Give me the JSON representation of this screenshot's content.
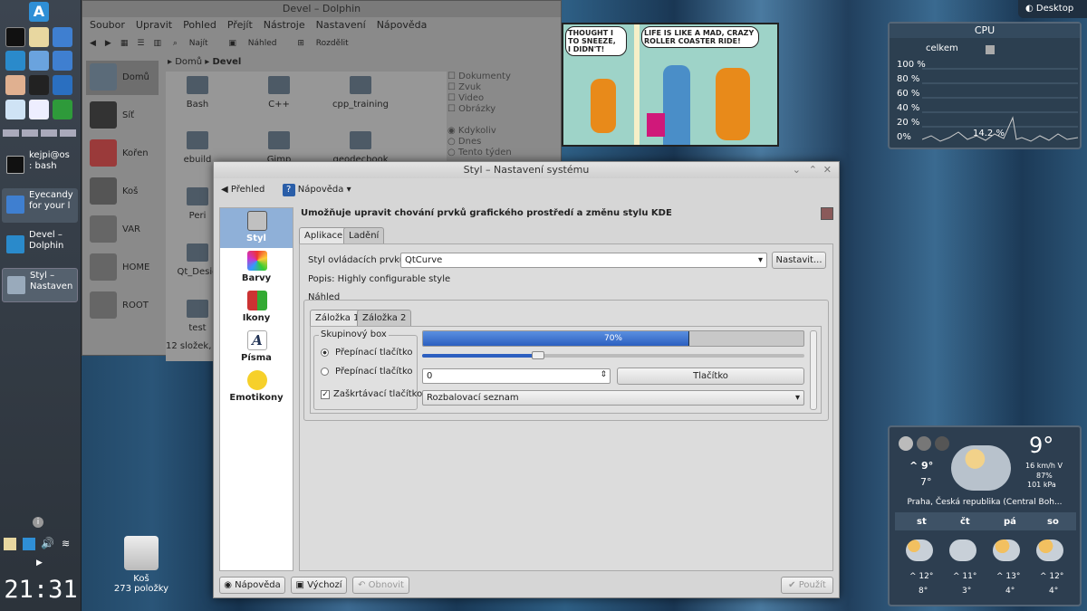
{
  "panel": {
    "clock": "21:31",
    "tasks": [
      {
        "label": "kejpi@os\n: bash"
      },
      {
        "label": "Eyecandy\nfor your l"
      },
      {
        "label": "Devel –\nDolphin"
      },
      {
        "label": "Styl –\nNastaven"
      }
    ]
  },
  "desktop": {
    "top_label": "Desktop",
    "trash_name": "Koš",
    "trash_count": "273 položky"
  },
  "dolphin": {
    "title": "Devel – Dolphin",
    "menu": [
      "Soubor",
      "Upravit",
      "Pohled",
      "Přejít",
      "Nástroje",
      "Nastavení",
      "Nápověda"
    ],
    "toolbar": [
      "Najít",
      "Náhled",
      "Rozdělit"
    ],
    "breadcrumb": [
      "Domů",
      "Devel"
    ],
    "places": [
      "Domů",
      "Síť",
      "Kořen",
      "Koš",
      "VAR",
      "HOME",
      "ROOT"
    ],
    "files": [
      "Bash",
      "C++",
      "cpp_training",
      "ebuild",
      "Gimp",
      "geodecbook",
      "Peri",
      "Qt_Desig",
      "test"
    ],
    "status": "12 složek, 2",
    "filters": [
      "Dokumenty",
      "Zvuk",
      "Video",
      "Obrázky"
    ],
    "dates": [
      "Kdykoliv",
      "Dnes",
      "Tento týden"
    ]
  },
  "comic": {
    "bubble1": "THOUGHT I\nTO SNEEZE,\nI DIDN'T!",
    "bubble2": "LIFE IS LIKE A MAD, CRAZY\nROLLER COASTER RIDE!"
  },
  "cpu": {
    "title": "CPU",
    "legend": "celkem",
    "levels": [
      "100 %",
      "80 %",
      "60 %",
      "40 %",
      "20 %",
      "0%"
    ],
    "current": "14.2 %"
  },
  "weather": {
    "temp": "9°",
    "high": "^ 9°",
    "low": "7°",
    "wind": "16 km/h V",
    "humidity": "87%",
    "pressure": "101 kPa",
    "location": "Praha, Česká republika (Central Boh...",
    "days": [
      {
        "name": "st",
        "high": "^ 12°",
        "low": "8°"
      },
      {
        "name": "čt",
        "high": "^ 11°",
        "low": "3°"
      },
      {
        "name": "pá",
        "high": "^ 13°",
        "low": "4°"
      },
      {
        "name": "so",
        "high": "^ 12°",
        "low": "4°"
      }
    ]
  },
  "dialog": {
    "title": "Styl – Nastavení systému",
    "back": "Přehled",
    "help_top": "Nápověda",
    "heading": "Umožňuje upravit chování prvků grafického prostředí a změnu stylu KDE",
    "categories": [
      "Styl",
      "Barvy",
      "Ikony",
      "Písma",
      "Emotikony"
    ],
    "tabs": [
      "Aplikace",
      "Ladění"
    ],
    "widget_style_label": "Styl ovládacích prvků:",
    "widget_style_value": "QtCurve",
    "configure": "Nastavit...",
    "description": "Popis: Highly configurable style",
    "preview_label": "Náhled",
    "preview_tabs": [
      "Záložka 1",
      "Záložka 2"
    ],
    "groupbox": "Skupinový box",
    "radio1": "Přepínací tlačítko",
    "radio2": "Přepínací tlačítko",
    "checkbox": "Zaškrtávací tlačítko",
    "progress_label": "70%",
    "progress": 0.7,
    "spin_value": "0",
    "button": "Tlačítko",
    "combo": "Rozbalovací seznam",
    "footer": {
      "help": "Nápověda",
      "defaults": "Výchozí",
      "reset": "Obnovit",
      "apply": "Použít"
    }
  }
}
